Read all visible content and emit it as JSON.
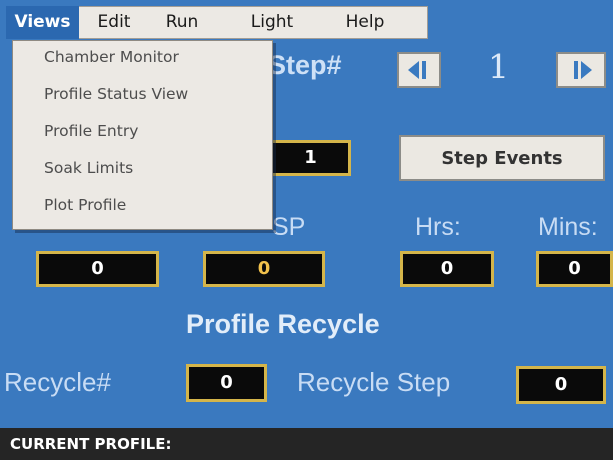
{
  "menubar": {
    "items": [
      {
        "label": "Views",
        "active": true
      },
      {
        "label": "Edit",
        "active": false
      },
      {
        "label": "Run",
        "active": false
      },
      {
        "label": "Light",
        "active": false
      },
      {
        "label": "Help",
        "active": false
      }
    ]
  },
  "views_menu": {
    "items": [
      "Chamber Monitor",
      "Profile Status View",
      "Profile Entry",
      "Soak Limits",
      "Plot Profile"
    ]
  },
  "step": {
    "label": "Step#",
    "value": "1",
    "prev_icon": "step-back-icon",
    "next_icon": "step-forward-icon"
  },
  "step_box_value": "1",
  "step_events_label": "Step Events",
  "columns": {
    "sp_label": "SP",
    "hrs_label": "Hrs:",
    "mins_label": "Mins:",
    "first_value": "0",
    "sp_value": "0",
    "hrs_value": "0",
    "mins_value": "0"
  },
  "recycle": {
    "title": "Profile Recycle",
    "recycle_label": "Recycle#",
    "recycle_value": "0",
    "step_label": "Recycle Step",
    "step_value": "0"
  },
  "status": {
    "label": "CURRENT PROFILE:"
  },
  "colors": {
    "background": "#3a79bf",
    "menu_bg": "#ece9e4",
    "box_border": "#d4b54a",
    "status_bar": "#252525"
  }
}
